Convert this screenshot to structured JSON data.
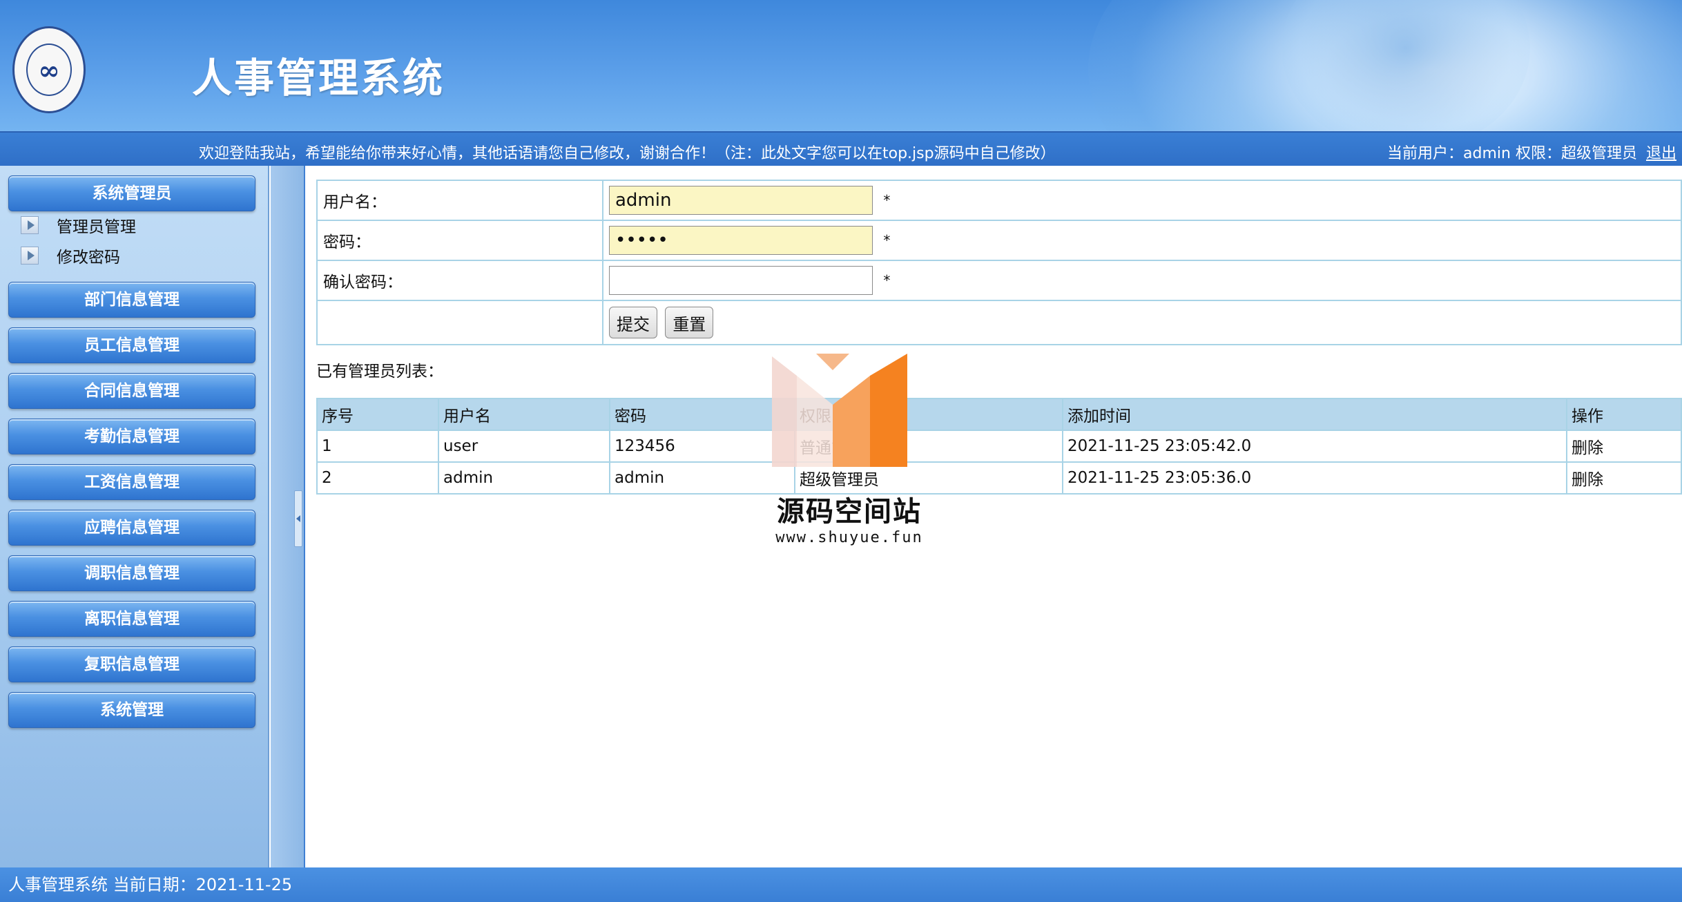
{
  "header": {
    "app_title": "人事管理系统",
    "logo_glyph": "∞"
  },
  "topbar": {
    "welcome_text": "欢迎登陆我站，希望能给你带来好心情，其他话语请您自己修改，谢谢合作！（注：此处文字您可以在top.jsp源码中自己修改）",
    "user_info_text": "当前用户：admin 权限：超级管理员",
    "logout_label": "退出"
  },
  "sidebar": {
    "section_title": "系统管理员",
    "sub_items": [
      "管理员管理",
      "修改密码"
    ],
    "menu": [
      "部门信息管理",
      "员工信息管理",
      "合同信息管理",
      "考勤信息管理",
      "工资信息管理",
      "应聘信息管理",
      "调职信息管理",
      "离职信息管理",
      "复职信息管理",
      "系统管理"
    ]
  },
  "form": {
    "username_label": "用户名：",
    "username_value": "admin",
    "password_label": "密码：",
    "password_value": "•••••",
    "confirm_label": "确认密码：",
    "confirm_value": "",
    "required_mark": "*",
    "submit_label": "提交",
    "reset_label": "重置"
  },
  "list": {
    "title": "已有管理员列表：",
    "columns": [
      "序号",
      "用户名",
      "密码",
      "权限",
      "添加时间",
      "操作"
    ],
    "rows": [
      {
        "id": "1",
        "username": "user",
        "password": "123456",
        "role": "普通管理员",
        "added": "2021-11-25 23:05:42.0",
        "action": "删除"
      },
      {
        "id": "2",
        "username": "admin",
        "password": "admin",
        "role": "超级管理员",
        "added": "2021-11-25 23:05:36.0",
        "action": "删除"
      }
    ]
  },
  "watermark": {
    "name": "源码空间站",
    "url": "www.shuyue.fun"
  },
  "footer": {
    "text": "人事管理系统 当前日期：2021-11-25"
  },
  "colors": {
    "header_blue": "#3f88dc",
    "menu_button": "#4a90e2",
    "table_border": "#a8d3e6",
    "table_header": "#b6d7ec",
    "input_highlight": "#fbf6c4",
    "watermark_orange": "#f58220"
  }
}
